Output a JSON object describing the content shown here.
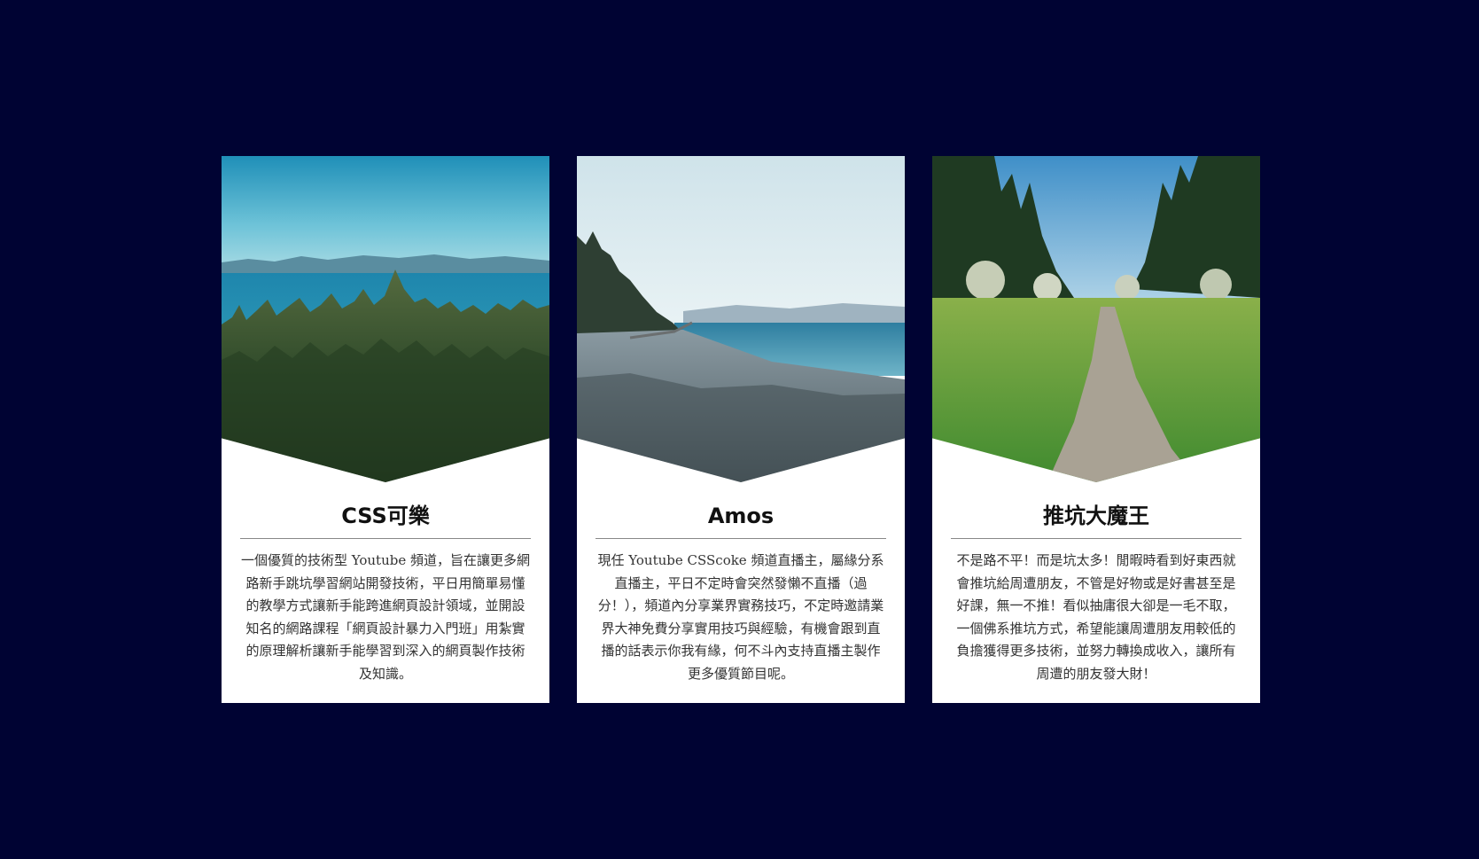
{
  "cards": [
    {
      "title": "CSS可樂",
      "description": "一個優質的技術型 Youtube 頻道，旨在讓更多網路新手跳坑學習網站開發技術，平日用簡單易懂的教學方式讓新手能跨進網頁設計領域，並開設知名的網路課程「網頁設計暴力入門班」用紮實的原理解析讓新手能學習到深入的網頁製作技術及知識。",
      "image": "forest-lake-photo"
    },
    {
      "title": "Amos",
      "description": "現任 Youtube CSScoke 頻道直播主，屬緣分系直播主，平日不定時會突然發懶不直播（過分！），頻道內分享業界實務技巧，不定時邀請業界大神免費分享實用技巧與經驗，有機會跟到直播的話表示你我有緣，何不斗內支持直播主製作更多優質節目呢。",
      "image": "pebble-beach-photo"
    },
    {
      "title": "推坑大魔王",
      "description": "不是路不平！而是坑太多！閒暇時看到好東西就會推坑給周遭朋友，不管是好物或是好書甚至是好課，無一不推！看似抽庸很大卻是一毛不取，一個佛系推坑方式，希望能讓周遭朋友用較低的負擔獲得更多技術，並努力轉換成收入，讓所有周遭的朋友發大財！",
      "image": "meadow-path-photo"
    }
  ],
  "colors": {
    "background": "#000333",
    "card": "#ffffff",
    "title": "#111111",
    "text": "#333333"
  }
}
